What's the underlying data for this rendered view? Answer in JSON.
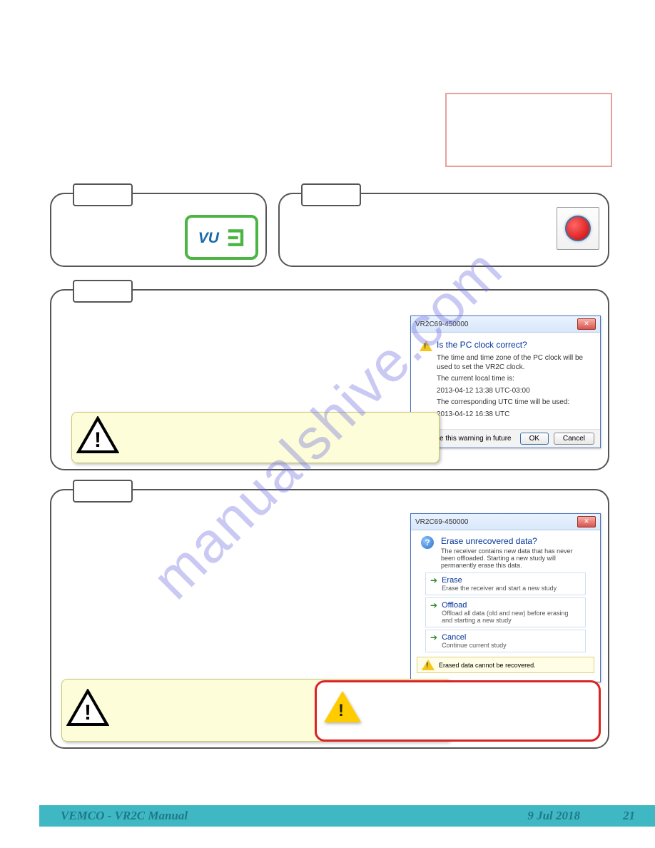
{
  "watermark": "manualshive.com",
  "dialog1": {
    "title": "VR2C69-450000",
    "heading": "Is the PC clock correct?",
    "p1": "The time and time zone of the PC clock will be used to set the VR2C clock.",
    "p2": "The current local time is:",
    "t1": "2013-04-12 13:38 UTC-03:00",
    "p3": "The corresponding UTC time will be used:",
    "t2": "2013-04-12 16:38 UTC",
    "hide": "Hide this warning in future",
    "ok": "OK",
    "cancel": "Cancel"
  },
  "dialog2": {
    "title": "VR2C69-450000",
    "heading": "Erase unrecovered data?",
    "sub": "The receiver contains new data that has never been offloaded. Starting a new study will permanently erase this data.",
    "opt1": {
      "title": "Erase",
      "sub": "Erase the receiver and start a new study"
    },
    "opt2": {
      "title": "Offload",
      "sub": "Offload all data (old and new) before erasing and starting a new study"
    },
    "opt3": {
      "title": "Cancel",
      "sub": "Continue current study"
    },
    "warn": "Erased data cannot be recovered."
  },
  "footer": {
    "left": "VEMCO - VR2C Manual",
    "date": "9 Jul 2018",
    "page": "21"
  }
}
